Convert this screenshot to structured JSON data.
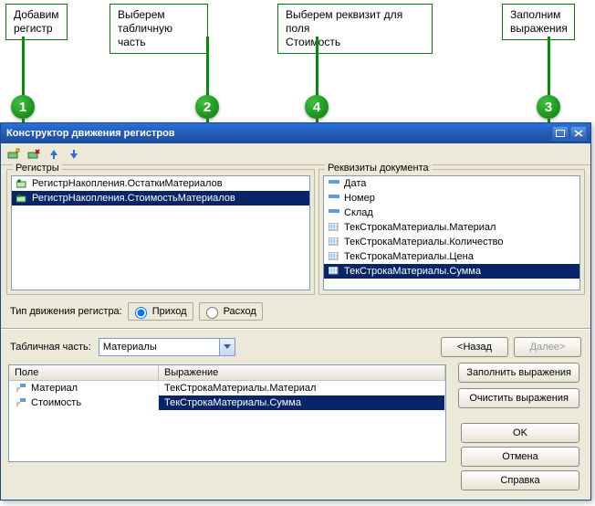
{
  "callouts": {
    "c1": "Добавим\nрегистр",
    "c2": "Выберем\nтабличную часть",
    "c3": "Заполним\nвыражения",
    "c4": "Выберем реквизит для поля\nСтоимость",
    "n1": "1",
    "n2": "2",
    "n3": "3",
    "n4": "4"
  },
  "dialog": {
    "title": "Конструктор движения регистров",
    "registers_label": "Регистры",
    "requisites_label": "Реквизиты документа",
    "registers": [
      "РегистрНакопления.ОстаткиМатериалов",
      "РегистрНакопления.СтоимостьМатериалов"
    ],
    "requisites": [
      "Дата",
      "Номер",
      "Склад",
      "ТекСтрокаМатериалы.Материал",
      "ТекСтрокаМатериалы.Количество",
      "ТекСтрокаМатериалы.Цена",
      "ТекСтрокаМатериалы.Сумма"
    ],
    "movetype_label": "Тип движения регистра:",
    "movetype_in": "Приход",
    "movetype_out": "Расход",
    "tabpart_label": "Табличная часть:",
    "tabpart_value": "Материалы",
    "grid": {
      "col1": "Поле",
      "col2": "Выражение",
      "rows": [
        {
          "f": "Материал",
          "e": "ТекСтрокаМатериалы.Материал"
        },
        {
          "f": "Стоимость",
          "e": "ТекСтрокаМатериалы.Сумма"
        }
      ]
    },
    "buttons": {
      "back": "<Назад",
      "next": "Далее>",
      "fill": "Заполнить выражения",
      "clear": "Очистить выражения",
      "ok": "OK",
      "cancel": "Отмена",
      "help": "Справка"
    }
  }
}
